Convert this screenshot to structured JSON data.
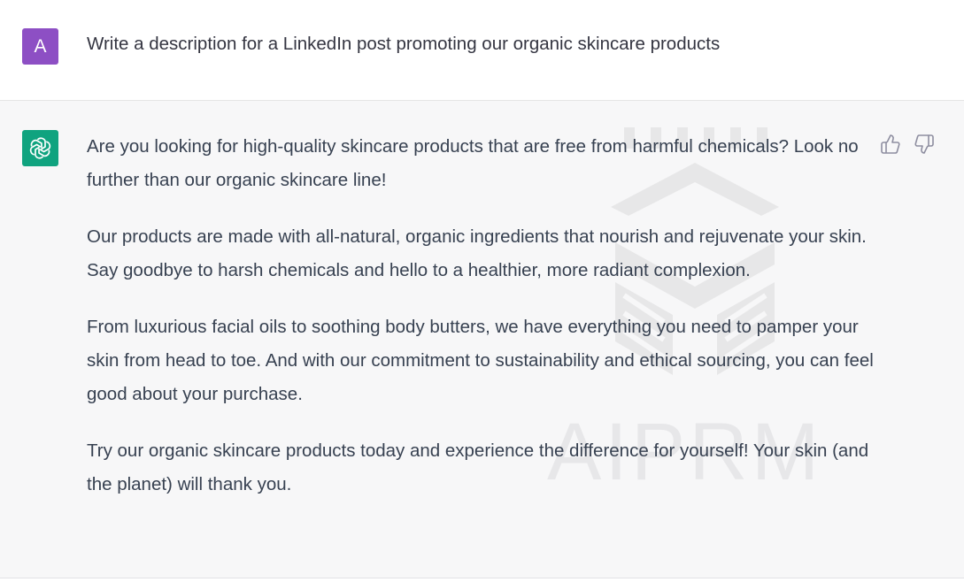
{
  "user_message": {
    "avatar_initial": "A",
    "text": "Write a description for a LinkedIn post promoting our organic skincare products"
  },
  "assistant_message": {
    "paragraphs": [
      "Are you looking for high-quality skincare products that are free from harmful chemicals? Look no further than our organic skincare line!",
      "Our products are made with all-natural, organic ingredients that nourish and rejuvenate your skin. Say goodbye to harsh chemicals and hello to a healthier, more radiant complexion.",
      "From luxurious facial oils to soothing body butters, we have everything you need to pamper your skin from head to toe. And with our commitment to sustainability and ethical sourcing, you can feel good about your purchase.",
      "Try our organic skincare products today and experience the difference for yourself! Your skin (and the planet) will thank you."
    ],
    "watermark_text": "AIPRM"
  },
  "icons": {
    "user_avatar": "user-avatar",
    "assistant_avatar": "openai-logo-icon",
    "thumb_up": "thumbs-up-icon",
    "thumb_down": "thumbs-down-icon"
  },
  "colors": {
    "user_avatar_bg": "#8d4fc4",
    "assistant_avatar_bg": "#10a37f",
    "assistant_row_bg": "#f7f7f8",
    "text": "#374151"
  }
}
